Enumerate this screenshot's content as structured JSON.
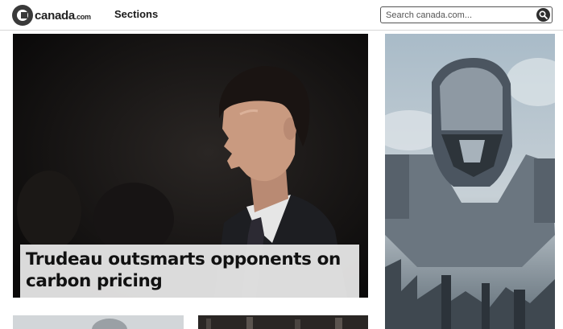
{
  "header": {
    "logo": {
      "name": "canada",
      "tld": ".com"
    },
    "sections_label": "Sections",
    "search": {
      "placeholder": "Search canada.com...",
      "value": ""
    }
  },
  "hero_story": {
    "headline": "Trudeau outsmarts opponents on carbon pricing"
  },
  "icons": {
    "logo": "speech-bubble-logo-icon",
    "search": "search-icon"
  },
  "colors": {
    "header_background": "#ffffff",
    "headline_box": "#ebebeb",
    "hero_background": "#0c0b0b",
    "search_button": "#2e2e2e"
  }
}
